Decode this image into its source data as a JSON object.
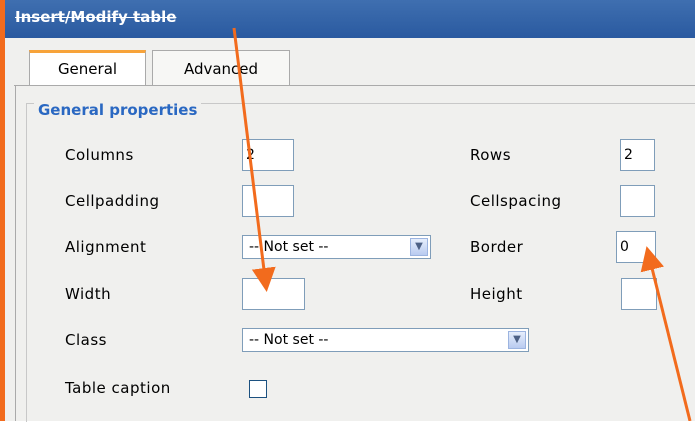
{
  "dialog": {
    "title": "Insert/Modify table"
  },
  "tabs": [
    {
      "label": "General"
    },
    {
      "label": "Advanced"
    }
  ],
  "general": {
    "legend": "General properties",
    "columns": {
      "label": "Columns",
      "value": "2"
    },
    "rows": {
      "label": "Rows",
      "value": "2"
    },
    "cellpadding": {
      "label": "Cellpadding",
      "value": ""
    },
    "cellspacing": {
      "label": "Cellspacing",
      "value": ""
    },
    "alignment": {
      "label": "Alignment",
      "value": "-- Not set --"
    },
    "border": {
      "label": "Border",
      "value": "0"
    },
    "width": {
      "label": "Width",
      "value": ""
    },
    "height": {
      "label": "Height",
      "value": ""
    },
    "class": {
      "label": "Class",
      "value": "-- Not set --"
    },
    "caption": {
      "label": "Table caption",
      "checked": false
    }
  },
  "colors": {
    "annotation_arrow": "#f26b1d",
    "accent_tab": "#f7a33a",
    "legend_text": "#2a68c2",
    "title_bar": "#2a5aa0"
  }
}
